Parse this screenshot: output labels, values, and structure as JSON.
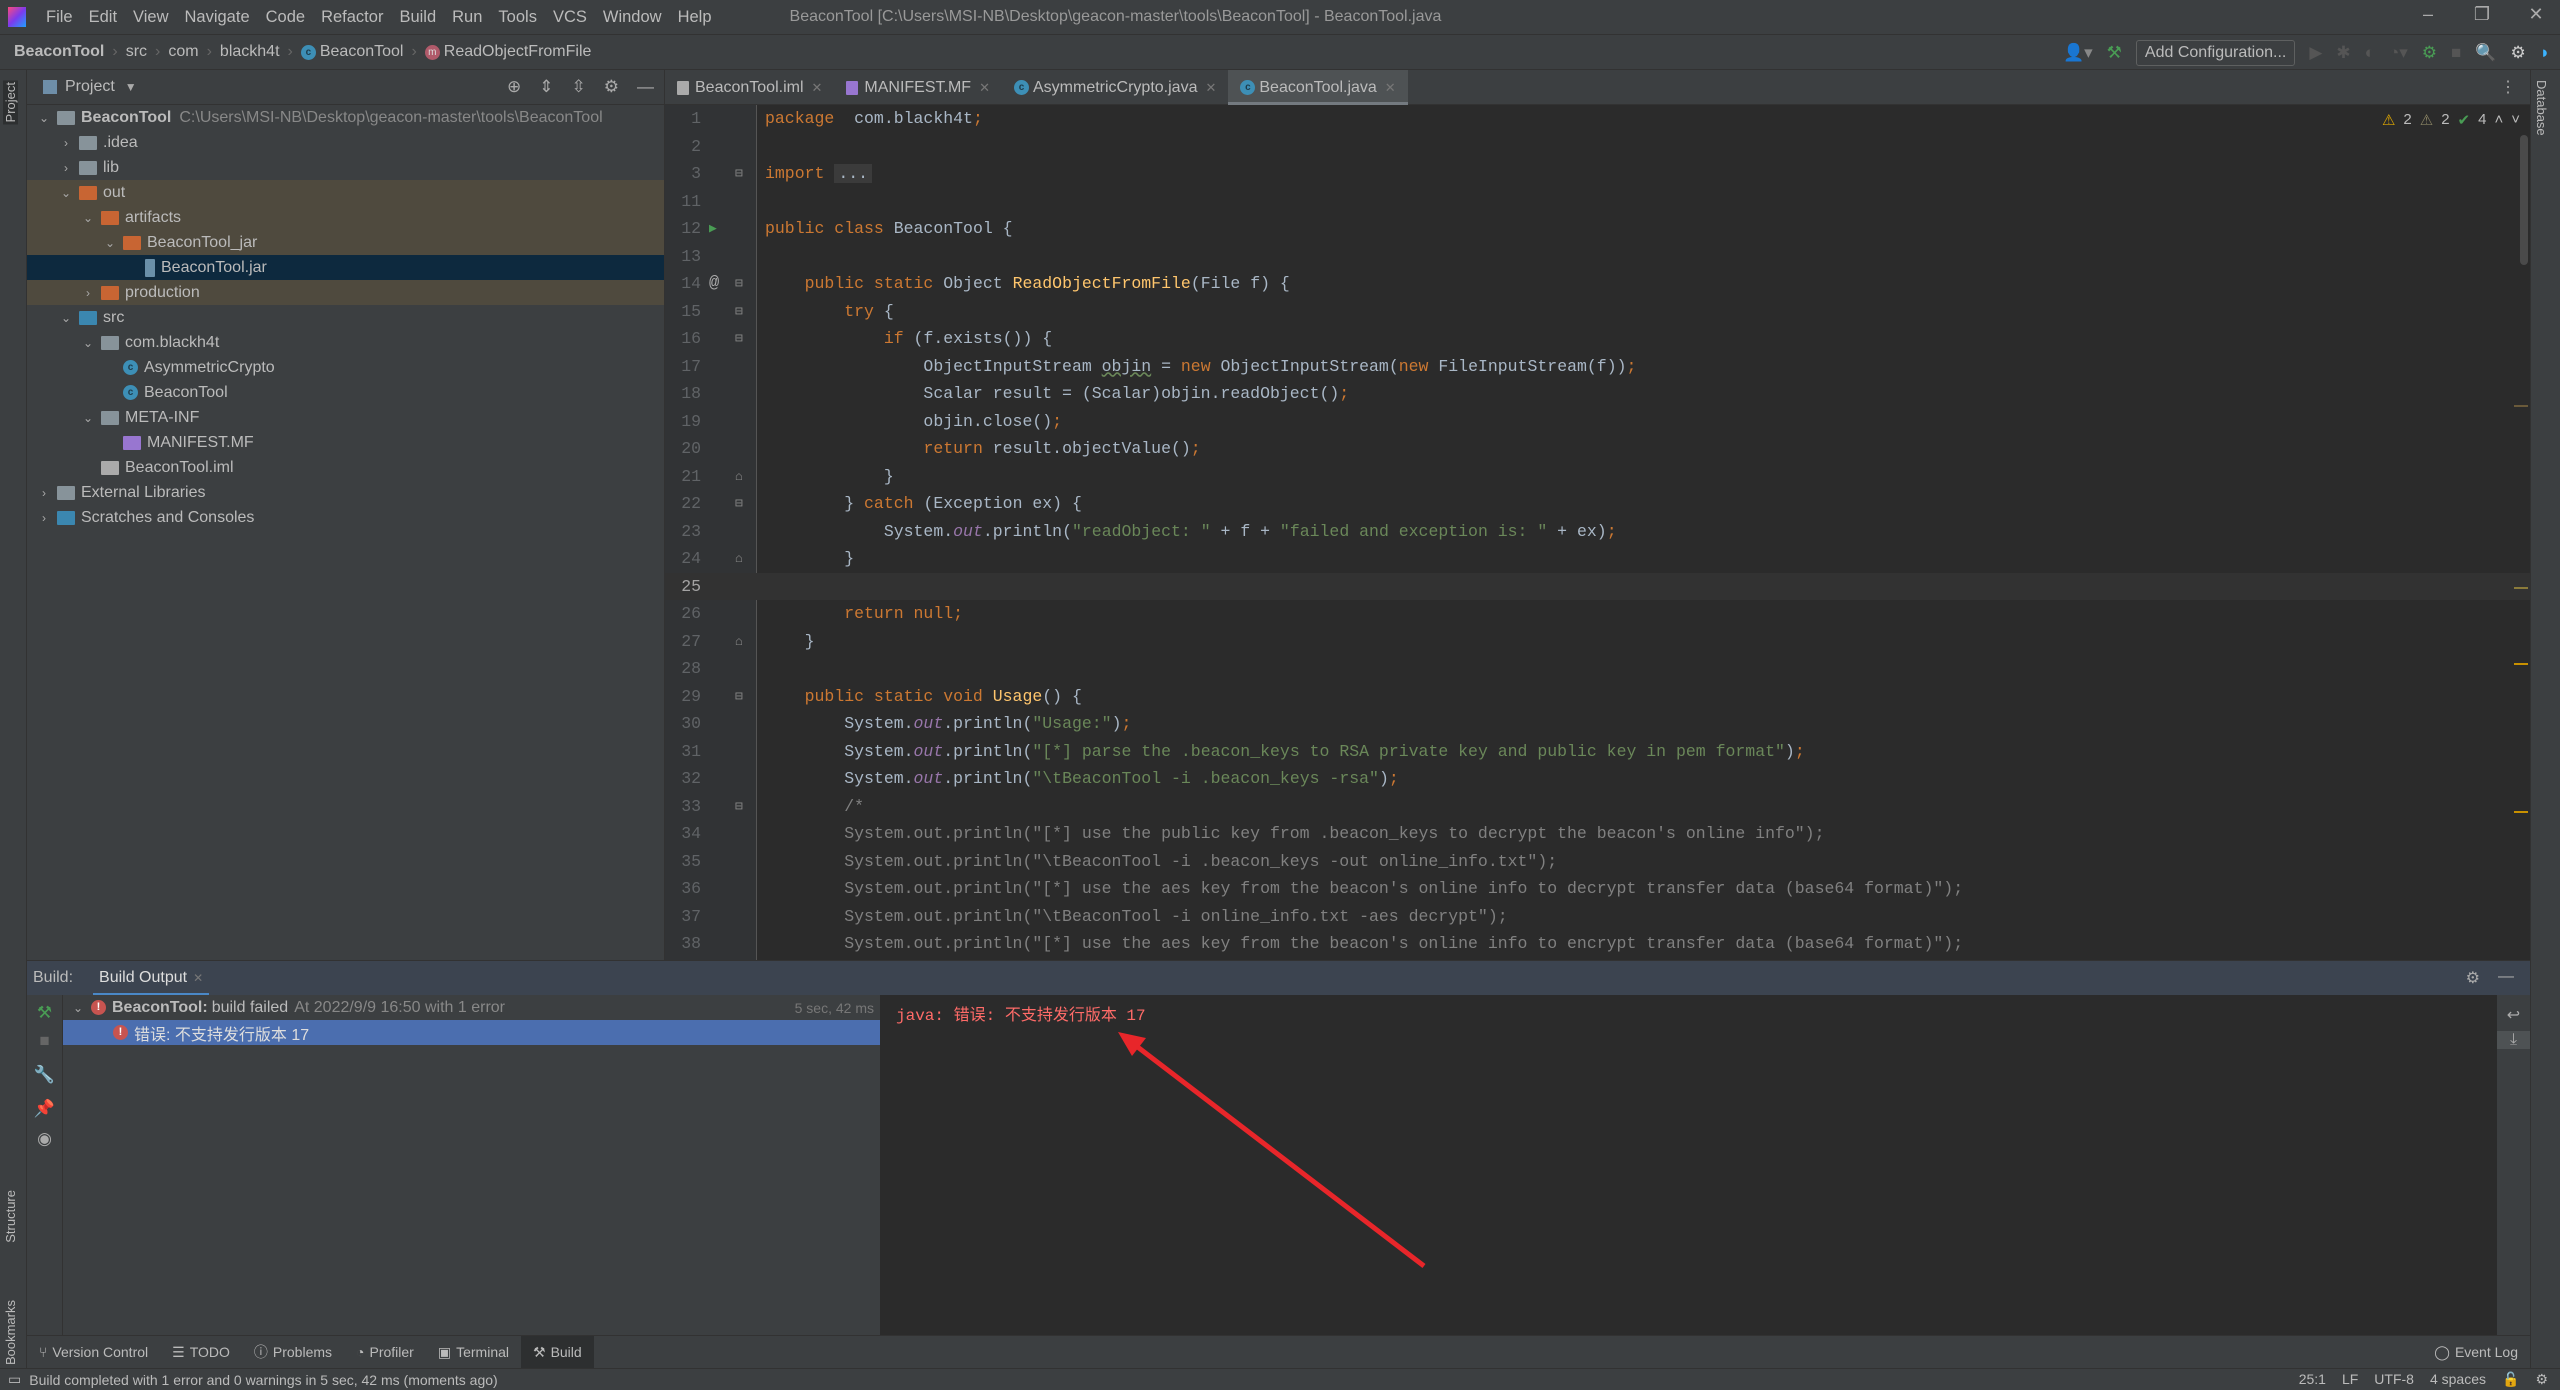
{
  "app": {
    "window_title": "BeaconTool [C:\\Users\\MSI-NB\\Desktop\\geacon-master\\tools\\BeaconTool] - BeaconTool.java",
    "menu": [
      "File",
      "Edit",
      "View",
      "Navigate",
      "Code",
      "Refactor",
      "Build",
      "Run",
      "Tools",
      "VCS",
      "Window",
      "Help"
    ]
  },
  "breadcrumb": [
    "BeaconTool",
    "src",
    "com",
    "blackh4t",
    "BeaconTool",
    "ReadObjectFromFile"
  ],
  "toolbar": {
    "add_configuration": "Add Configuration..."
  },
  "project": {
    "header": "Project",
    "tree": [
      {
        "label": "BeaconTool",
        "path": "C:\\Users\\MSI-NB\\Desktop\\geacon-master\\tools\\BeaconTool",
        "depth": 0,
        "arrow": "down",
        "icon": "module",
        "bold": true
      },
      {
        "label": ".idea",
        "depth": 1,
        "arrow": "right",
        "icon": "folder"
      },
      {
        "label": "lib",
        "depth": 1,
        "arrow": "right",
        "icon": "folder"
      },
      {
        "label": "out",
        "depth": 1,
        "arrow": "down",
        "icon": "folder-excluded",
        "state": "hl"
      },
      {
        "label": "artifacts",
        "depth": 2,
        "arrow": "down",
        "icon": "folder-excluded",
        "state": "hl"
      },
      {
        "label": "BeaconTool_jar",
        "depth": 3,
        "arrow": "down",
        "icon": "folder-excluded",
        "state": "hl"
      },
      {
        "label": "BeaconTool.jar",
        "depth": 4,
        "arrow": "",
        "icon": "jar",
        "state": "sel"
      },
      {
        "label": "production",
        "depth": 2,
        "arrow": "right",
        "icon": "folder-excluded",
        "state": "hl"
      },
      {
        "label": "src",
        "depth": 1,
        "arrow": "down",
        "icon": "folder-source"
      },
      {
        "label": "com.blackh4t",
        "depth": 2,
        "arrow": "down",
        "icon": "package"
      },
      {
        "label": "AsymmetricCrypto",
        "depth": 3,
        "arrow": "",
        "icon": "class"
      },
      {
        "label": "BeaconTool",
        "depth": 3,
        "arrow": "",
        "icon": "class"
      },
      {
        "label": "META-INF",
        "depth": 2,
        "arrow": "down",
        "icon": "folder"
      },
      {
        "label": "MANIFEST.MF",
        "depth": 3,
        "arrow": "",
        "icon": "manifest"
      },
      {
        "label": "BeaconTool.iml",
        "depth": 2,
        "arrow": "",
        "icon": "file"
      },
      {
        "label": "External Libraries",
        "depth": 0,
        "arrow": "right",
        "icon": "libraries"
      },
      {
        "label": "Scratches and Consoles",
        "depth": 0,
        "arrow": "right",
        "icon": "scratches"
      }
    ]
  },
  "tabs": [
    {
      "label": "BeaconTool.iml",
      "icon": "file"
    },
    {
      "label": "MANIFEST.MF",
      "icon": "manifest"
    },
    {
      "label": "AsymmetricCrypto.java",
      "icon": "class"
    },
    {
      "label": "BeaconTool.java",
      "icon": "class",
      "active": true
    }
  ],
  "inspections": {
    "warnings": "2",
    "weak_warnings": "2",
    "typos": "4"
  },
  "editor": {
    "current_line": "25",
    "lines": [
      {
        "n": "1",
        "t": [
          [
            "kw",
            "package"
          ],
          [
            "",
            "  com.blackh4t"
          ],
          [
            "kw",
            ";"
          ]
        ]
      },
      {
        "n": "2",
        "t": []
      },
      {
        "n": "3",
        "t": [
          [
            "kw",
            "import"
          ],
          [
            "",
            " "
          ],
          [
            "fold",
            "..."
          ]
        ]
      },
      {
        "n": "11",
        "t": []
      },
      {
        "n": "12",
        "t": [
          [
            "kw",
            "public class"
          ],
          [
            "",
            " BeaconTool {"
          ]
        ]
      },
      {
        "n": "13",
        "t": []
      },
      {
        "n": "14",
        "t": [
          [
            "",
            "    "
          ],
          [
            "kw",
            "public static"
          ],
          [
            "",
            " Object "
          ],
          [
            "fn",
            "ReadObjectFromFile"
          ],
          [
            "",
            "(File f) {"
          ]
        ]
      },
      {
        "n": "15",
        "t": [
          [
            "",
            "        "
          ],
          [
            "kw",
            "try"
          ],
          [
            "",
            " {"
          ]
        ]
      },
      {
        "n": "16",
        "t": [
          [
            "",
            "            "
          ],
          [
            "kw",
            "if"
          ],
          [
            "",
            " (f.exists()) {"
          ]
        ]
      },
      {
        "n": "17",
        "t": [
          [
            "",
            "                ObjectInputStream "
          ],
          [
            "und",
            "objin"
          ],
          [
            "",
            " = "
          ],
          [
            "kw",
            "new"
          ],
          [
            "",
            " ObjectInputStream("
          ],
          [
            "kw",
            "new"
          ],
          [
            "",
            " FileInputStream(f))"
          ],
          [
            "kw",
            ";"
          ]
        ]
      },
      {
        "n": "18",
        "t": [
          [
            "",
            "                Scalar result = (Scalar)objin.readObject()"
          ],
          [
            "kw",
            ";"
          ]
        ]
      },
      {
        "n": "19",
        "t": [
          [
            "",
            "                objin.close()"
          ],
          [
            "kw",
            ";"
          ]
        ]
      },
      {
        "n": "20",
        "t": [
          [
            "",
            "                "
          ],
          [
            "kw",
            "return"
          ],
          [
            "",
            " result.objectValue()"
          ],
          [
            "kw",
            ";"
          ]
        ]
      },
      {
        "n": "21",
        "t": [
          [
            "",
            "            }"
          ]
        ]
      },
      {
        "n": "22",
        "t": [
          [
            "",
            "        } "
          ],
          [
            "kw",
            "catch"
          ],
          [
            "",
            " (Exception ex) {"
          ]
        ]
      },
      {
        "n": "23",
        "t": [
          [
            "",
            "            System."
          ],
          [
            "fld",
            "out"
          ],
          [
            "",
            ".println("
          ],
          [
            "str",
            "\"readObject: \""
          ],
          [
            "",
            " + f + "
          ],
          [
            "str",
            "\"failed and exception is: \""
          ],
          [
            "",
            " + ex)"
          ],
          [
            "kw",
            ";"
          ]
        ]
      },
      {
        "n": "24",
        "t": [
          [
            "",
            "        }"
          ]
        ]
      },
      {
        "n": "25",
        "t": []
      },
      {
        "n": "26",
        "t": [
          [
            "",
            "        "
          ],
          [
            "kw",
            "return null;"
          ]
        ]
      },
      {
        "n": "27",
        "t": [
          [
            "",
            "    }"
          ]
        ]
      },
      {
        "n": "28",
        "t": []
      },
      {
        "n": "29",
        "t": [
          [
            "",
            "    "
          ],
          [
            "kw",
            "public static void"
          ],
          [
            "",
            " "
          ],
          [
            "fn",
            "Usage"
          ],
          [
            "",
            "() {"
          ]
        ]
      },
      {
        "n": "30",
        "t": [
          [
            "",
            "        System."
          ],
          [
            "fld",
            "out"
          ],
          [
            "",
            ".println("
          ],
          [
            "str",
            "\"Usage:\""
          ],
          [
            "",
            ")"
          ],
          [
            "kw",
            ";"
          ]
        ]
      },
      {
        "n": "31",
        "t": [
          [
            "",
            "        System."
          ],
          [
            "fld",
            "out"
          ],
          [
            "",
            ".println("
          ],
          [
            "str",
            "\"[*] parse the .beacon_keys to RSA private key and public key in pem format\""
          ],
          [
            "",
            ")"
          ],
          [
            "kw",
            ";"
          ]
        ]
      },
      {
        "n": "32",
        "t": [
          [
            "",
            "        System."
          ],
          [
            "fld",
            "out"
          ],
          [
            "",
            ".println("
          ],
          [
            "str",
            "\"\\tBeaconTool -i .beacon_keys -rsa\""
          ],
          [
            "",
            ")"
          ],
          [
            "kw",
            ";"
          ]
        ]
      },
      {
        "n": "33",
        "t": [
          [
            "",
            "        "
          ],
          [
            "cm",
            "/*"
          ]
        ]
      },
      {
        "n": "34",
        "t": [
          [
            "cm",
            "        System.out.println(\"[*] use the public key from .beacon_keys to decrypt the beacon's online info\");"
          ]
        ]
      },
      {
        "n": "35",
        "t": [
          [
            "cm",
            "        System.out.println(\"\\tBeaconTool -i .beacon_keys -out online_info.txt\");"
          ]
        ]
      },
      {
        "n": "36",
        "t": [
          [
            "cm",
            "        System.out.println(\"[*] use the aes key from the beacon's online info to decrypt transfer data (base64 format)\");"
          ]
        ]
      },
      {
        "n": "37",
        "t": [
          [
            "cm",
            "        System.out.println(\"\\tBeaconTool -i online_info.txt -aes decrypt\");"
          ]
        ]
      },
      {
        "n": "38",
        "t": [
          [
            "cm",
            "        System.out.println(\"[*] use the aes key from the beacon's online info to encrypt transfer data (base64 format)\");"
          ]
        ]
      }
    ]
  },
  "build": {
    "label": "Build:",
    "tab": "Build Output",
    "root": {
      "name": "BeaconTool:",
      "status": "build failed",
      "detail": "At 2022/9/9 16:50 with 1 error",
      "duration": "5 sec, 42 ms"
    },
    "error_item": "错误: 不支持发行版本 17",
    "output": "java: 错误: 不支持发行版本 17"
  },
  "tool_windows": [
    "Version Control",
    "TODO",
    "Problems",
    "Profiler",
    "Terminal",
    "Build"
  ],
  "event_log": "Event Log",
  "side_labels": {
    "project": "Project",
    "structure": "Structure",
    "bookmarks": "Bookmarks",
    "database": "Database"
  },
  "status": {
    "message": "Build completed with 1 error and 0 warnings in 5 sec, 42 ms (moments ago)",
    "position": "25:1",
    "line_sep": "LF",
    "encoding": "UTF-8",
    "indent": "4 spaces"
  },
  "colors": {
    "annotation_arrow": "#e8262a",
    "error": "#ff6b68",
    "keyword": "#cc7832",
    "string": "#6a8759"
  }
}
